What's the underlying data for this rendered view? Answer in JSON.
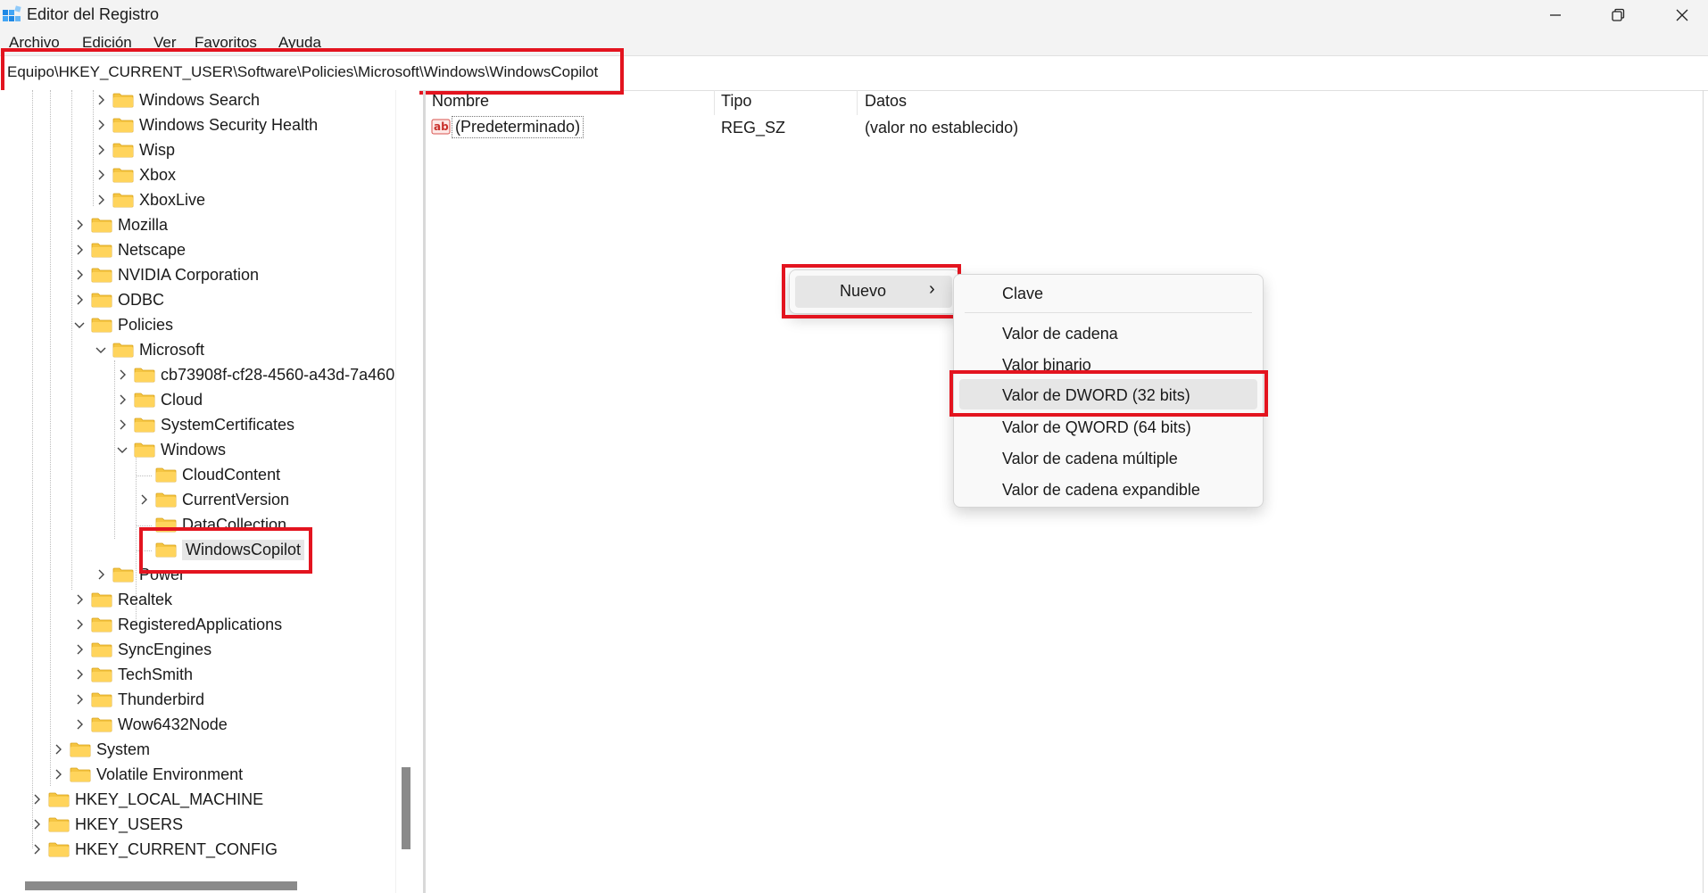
{
  "window": {
    "title": "Editor del Registro"
  },
  "menubar": [
    "Archivo",
    "Edición",
    "Ver",
    "Favoritos",
    "Ayuda"
  ],
  "address": "Equipo\\HKEY_CURRENT_USER\\Software\\Policies\\Microsoft\\Windows\\WindowsCopilot",
  "tree": [
    {
      "label": "Windows Search",
      "expander": "collapsed"
    },
    {
      "label": "Windows Security Health",
      "expander": "collapsed"
    },
    {
      "label": "Wisp",
      "expander": "collapsed"
    },
    {
      "label": "Xbox",
      "expander": "collapsed"
    },
    {
      "label": "XboxLive",
      "expander": "collapsed"
    },
    {
      "label": "Mozilla",
      "expander": "collapsed"
    },
    {
      "label": "Netscape",
      "expander": "collapsed"
    },
    {
      "label": "NVIDIA Corporation",
      "expander": "collapsed"
    },
    {
      "label": "ODBC",
      "expander": "collapsed"
    },
    {
      "label": "Policies",
      "expander": "expanded"
    },
    {
      "label": "Microsoft",
      "expander": "expanded"
    },
    {
      "label": "cb73908f-cf28-4560-a43d-7a460",
      "expander": "collapsed"
    },
    {
      "label": "Cloud",
      "expander": "collapsed"
    },
    {
      "label": "SystemCertificates",
      "expander": "collapsed"
    },
    {
      "label": "Windows",
      "expander": "expanded"
    },
    {
      "label": "CloudContent",
      "expander": "none"
    },
    {
      "label": "CurrentVersion",
      "expander": "collapsed"
    },
    {
      "label": "DataCollection",
      "expander": "none"
    },
    {
      "label": "WindowsCopilot",
      "expander": "none",
      "selected": true
    },
    {
      "label": "Power",
      "expander": "collapsed"
    },
    {
      "label": "Realtek",
      "expander": "collapsed"
    },
    {
      "label": "RegisteredApplications",
      "expander": "collapsed"
    },
    {
      "label": "SyncEngines",
      "expander": "collapsed"
    },
    {
      "label": "TechSmith",
      "expander": "collapsed"
    },
    {
      "label": "Thunderbird",
      "expander": "collapsed"
    },
    {
      "label": "Wow6432Node",
      "expander": "collapsed"
    },
    {
      "label": "System",
      "expander": "collapsed"
    },
    {
      "label": "Volatile Environment",
      "expander": "collapsed"
    },
    {
      "label": "HKEY_LOCAL_MACHINE",
      "expander": "collapsed"
    },
    {
      "label": "HKEY_USERS",
      "expander": "collapsed"
    },
    {
      "label": "HKEY_CURRENT_CONFIG",
      "expander": "collapsed"
    }
  ],
  "list": {
    "headers": {
      "name": "Nombre",
      "type": "Tipo",
      "data": "Datos"
    },
    "rows": [
      {
        "name": "(Predeterminado)",
        "type": "REG_SZ",
        "data": "(valor no establecido)",
        "icon": "string-value-icon"
      }
    ]
  },
  "context_menu": {
    "main": {
      "label": "Nuevo",
      "arrow": "›"
    },
    "submenu": [
      "Clave",
      "Valor de cadena",
      "Valor binario",
      "Valor de DWORD (32 bits)",
      "Valor de QWORD (64 bits)",
      "Valor de cadena múltiple",
      "Valor de cadena expandible"
    ],
    "highlighted": "Valor de DWORD (32 bits)"
  },
  "colors": {
    "highlight_red": "#e3141f",
    "folder": "#f5c542",
    "selection": "#e6e6e6"
  }
}
